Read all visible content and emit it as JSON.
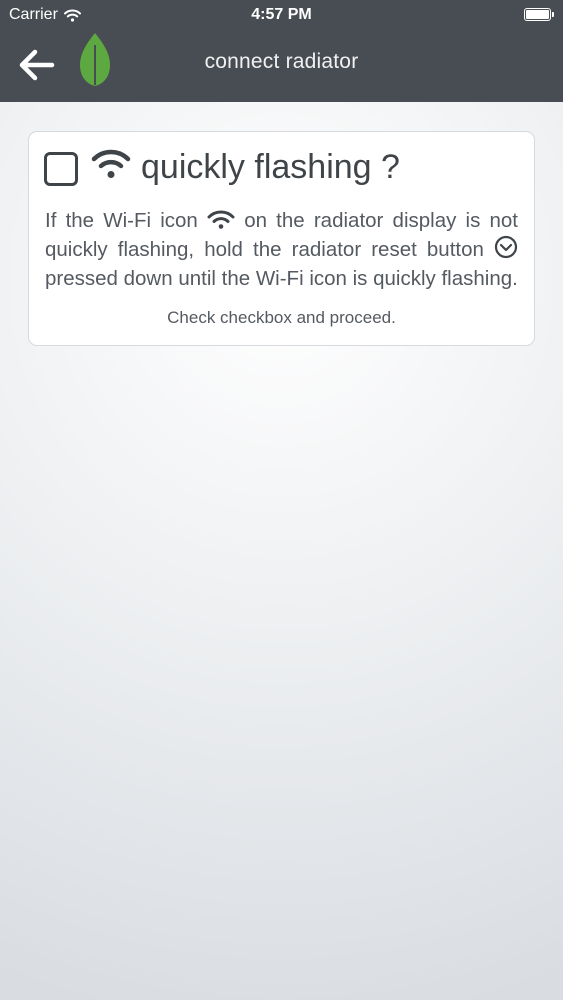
{
  "status_bar": {
    "carrier": "Carrier",
    "time": "4:57 PM"
  },
  "nav": {
    "title": "connect radiator",
    "back_icon": "arrow-left-icon",
    "logo_icon": "leaf-icon"
  },
  "card": {
    "headline": "quickly flashing ?",
    "body_part1": "If the Wi-Fi icon",
    "body_part2": "on the radiator display is not quickly flashing, hold the radiator reset button",
    "body_part3": "pressed down until the Wi-Fi icon is quickly flashing.",
    "hint": "Check checkbox and proceed.",
    "checkbox_checked": false
  },
  "colors": {
    "topbar": "#474d52",
    "leaf_green": "#5ea842",
    "text": "#4a4f55",
    "card_bg": "#ffffff"
  }
}
